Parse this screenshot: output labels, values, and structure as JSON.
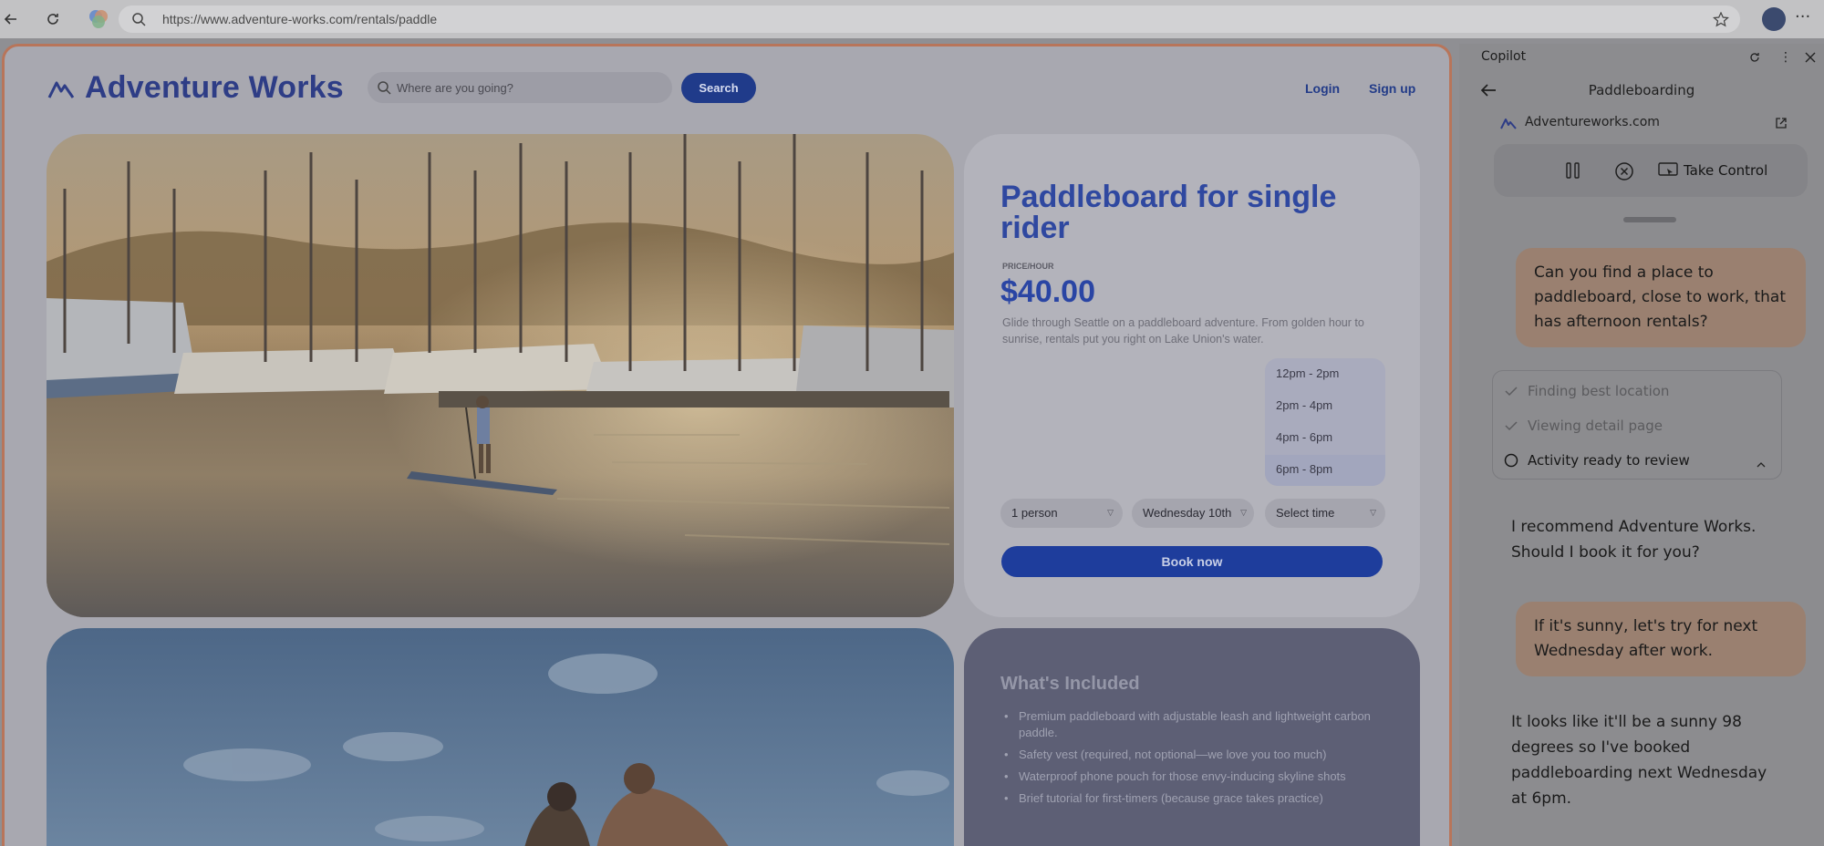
{
  "browser": {
    "url": "https://www.adventure-works.com/rentals/paddle",
    "back_icon": "back-arrow-icon",
    "refresh_icon": "refresh-icon",
    "copilot_icon": "copilot-logo-icon",
    "favorites_icon": "favorites-star-icon",
    "profile_icon": "profile-avatar",
    "menu_icon": "more-horizontal-icon"
  },
  "site": {
    "brand": "Adventure Works",
    "search_placeholder": "Where are you going?",
    "search_button": "Search",
    "login": "Login",
    "signup": "Sign up"
  },
  "booking": {
    "title": "Paddleboard for single rider",
    "price_label": "PRICE/HOUR",
    "price": "$40.00",
    "description": "Glide through Seattle on a paddleboard adventure. From golden hour to sunrise, rentals put you right on Lake Union's water.",
    "time_options": [
      "12pm - 2pm",
      "2pm - 4pm",
      "4pm - 6pm",
      "6pm - 8pm"
    ],
    "party_select": "1 person",
    "date_select": "Wednesday 10th",
    "time_select": "Select time",
    "book_button": "Book now"
  },
  "included": {
    "title": "What's Included",
    "items": [
      "Premium paddleboard with adjustable leash and lightweight carbon paddle.",
      "Safety vest (required, not optional—we love you too much)",
      "Waterproof phone pouch for those envy-inducing skyline shots",
      "Brief tutorial for first-timers (because grace takes practice)"
    ]
  },
  "copilot": {
    "title": "Copilot",
    "subtitle": "Paddleboarding",
    "source": "Adventureworks.com",
    "take_control": "Take Control",
    "messages": {
      "user_1": "Can you find a place to paddleboard, close to work, that has afternoon rentals?",
      "assistant_1": "I recommend Adventure Works. Should I book it for you?",
      "user_2": "If it's sunny, let's try for next Wednesday after work.",
      "assistant_2": "It looks like it'll be a sunny 98 degrees so I've booked paddleboarding next Wednesday at 6pm."
    },
    "steps": [
      {
        "label": "Finding best location",
        "status": "done"
      },
      {
        "label": "Viewing detail page",
        "status": "done"
      },
      {
        "label": "Activity ready to review",
        "status": "current"
      }
    ]
  },
  "colors": {
    "brand_blue": "#2f48a0",
    "frame_accent": "#b8755a",
    "user_bubble": "#9a8070"
  }
}
